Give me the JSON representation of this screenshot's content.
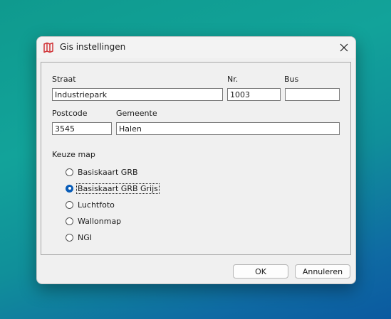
{
  "dialog": {
    "title": "Gis instellingen",
    "icon": "map-icon",
    "accent_color": "#d13438"
  },
  "form": {
    "straat_label": "Straat",
    "straat_value": "Industriepark",
    "nr_label": "Nr.",
    "nr_value": "1003",
    "bus_label": "Bus",
    "bus_value": "",
    "postcode_label": "Postcode",
    "postcode_value": "3545",
    "gemeente_label": "Gemeente",
    "gemeente_value": "Halen"
  },
  "map_choice": {
    "label": "Keuze map",
    "options": [
      {
        "label": "Basiskaart GRB",
        "selected": false
      },
      {
        "label": "Basiskaart GRB Grijs",
        "selected": true
      },
      {
        "label": "Luchtfoto",
        "selected": false
      },
      {
        "label": "Wallonmap",
        "selected": false
      },
      {
        "label": "NGI",
        "selected": false
      }
    ]
  },
  "buttons": {
    "ok": "OK",
    "cancel": "Annuleren"
  }
}
